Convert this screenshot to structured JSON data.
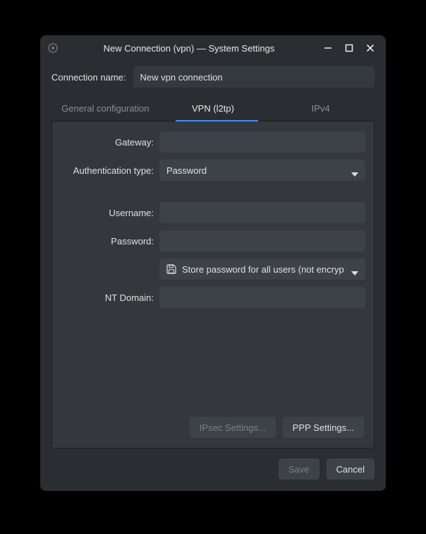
{
  "titlebar": {
    "title": "New Connection (vpn) — System Settings"
  },
  "connection_name": {
    "label": "Connection name:",
    "value": "New vpn connection"
  },
  "tabs": {
    "general": "General configuration",
    "vpn": "VPN (l2tp)",
    "ipv4": "IPv4",
    "active": "vpn"
  },
  "form": {
    "gateway_label": "Gateway:",
    "gateway_value": "",
    "auth_type_label": "Authentication type:",
    "auth_type_value": "Password",
    "username_label": "Username:",
    "username_value": "",
    "password_label": "Password:",
    "password_value": "",
    "store_password_value": "Store password for all users (not encryp",
    "nt_domain_label": "NT Domain:",
    "nt_domain_value": ""
  },
  "panel_buttons": {
    "ipsec": "IPsec Settings...",
    "ppp": "PPP Settings..."
  },
  "dialog_buttons": {
    "save": "Save",
    "cancel": "Cancel"
  }
}
